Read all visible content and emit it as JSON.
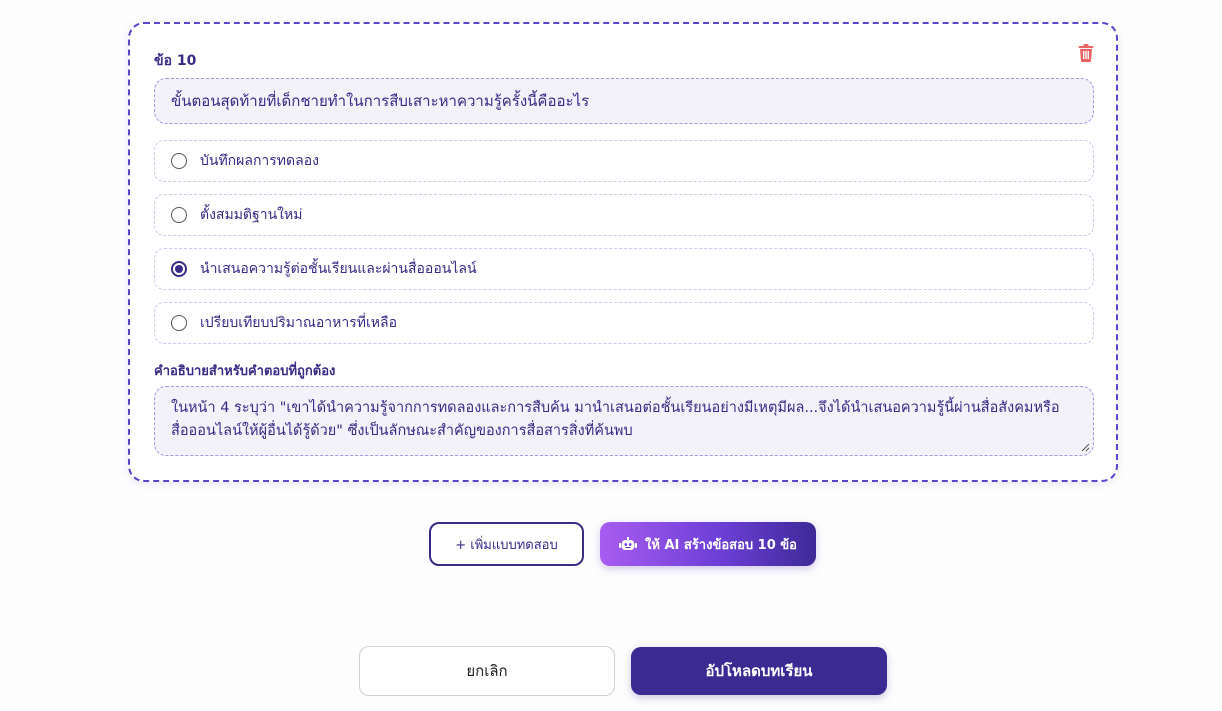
{
  "question": {
    "label": "ข้อ 10",
    "text": "ขั้นตอนสุดท้ายที่เด็กชายทำในการสืบเสาะหาความรู้ครั้งนี้คืออะไร",
    "delete_icon": "trash-icon",
    "options": [
      {
        "label": "บันทึกผลการทดลอง",
        "selected": false
      },
      {
        "label": "ตั้งสมมติฐานใหม่",
        "selected": false
      },
      {
        "label": "นำเสนอความรู้ต่อชั้นเรียนและผ่านสื่อออนไลน์",
        "selected": true
      },
      {
        "label": "เปรียบเทียบปริมาณอาหารที่เหลือ",
        "selected": false
      }
    ],
    "explanation_label": "คำอธิบายสำหรับคำตอบที่ถูกต้อง",
    "explanation_text": "ในหน้า 4 ระบุว่า \"เขาได้นำความรู้จากการทดลองและการสืบค้น มานำเสนอต่อชั้นเรียนอย่างมีเหตุมีผล...จึงได้นำเสนอความรู้นี้ผ่านสื่อสังคมหรือสื่อออนไลน์ให้ผู้อื่นได้รู้ด้วย\" ซึ่งเป็นลักษณะสำคัญของการสื่อสารสิ่งที่ค้นพบ"
  },
  "actions": {
    "add_quiz_label": "+ เพิ่มแบบทดสอบ",
    "ai_generate_label": "ให้ AI สร้างข้อสอบ 10 ข้อ",
    "ai_icon": "robot-icon",
    "cancel_label": "ยกเลิก",
    "upload_label": "อัปโหลดบทเรียน"
  },
  "colors": {
    "primary": "#3b2a92",
    "accent_gradient_start": "#a85cf0",
    "danger": "#e05a5a",
    "field_bg": "#f3f1fa"
  }
}
